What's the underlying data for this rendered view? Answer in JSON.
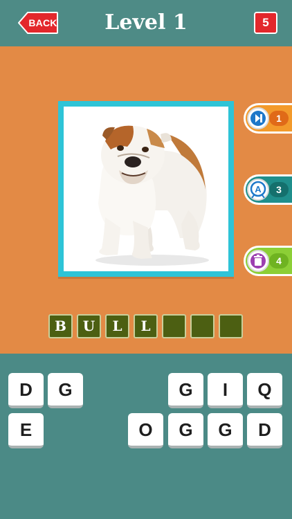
{
  "header": {
    "back_label": "BACK",
    "title": "Level 1",
    "coins": "5"
  },
  "hints": [
    {
      "icon": "skip-icon",
      "count": "1",
      "color": "#f39a2b"
    },
    {
      "icon": "reveal-letter-icon",
      "count": "3",
      "color": "#1f8f8c"
    },
    {
      "icon": "remove-letters-icon",
      "count": "4",
      "color": "#8ccf36"
    }
  ],
  "picture": {
    "subject": "bulldog-photo"
  },
  "answer": {
    "slots": [
      "B",
      "U",
      "L",
      "L",
      "",
      "",
      ""
    ]
  },
  "keyboard": {
    "row1": [
      "D",
      "G",
      "G",
      "I",
      "Q"
    ],
    "row2": [
      "E",
      "O",
      "G",
      "G",
      "D"
    ]
  },
  "colors": {
    "header_bg": "#4e8b86",
    "play_bg": "#e38a45",
    "frame": "#2ec4d7",
    "slot_bg": "#4c5f12",
    "back_button": "#e3272c"
  }
}
